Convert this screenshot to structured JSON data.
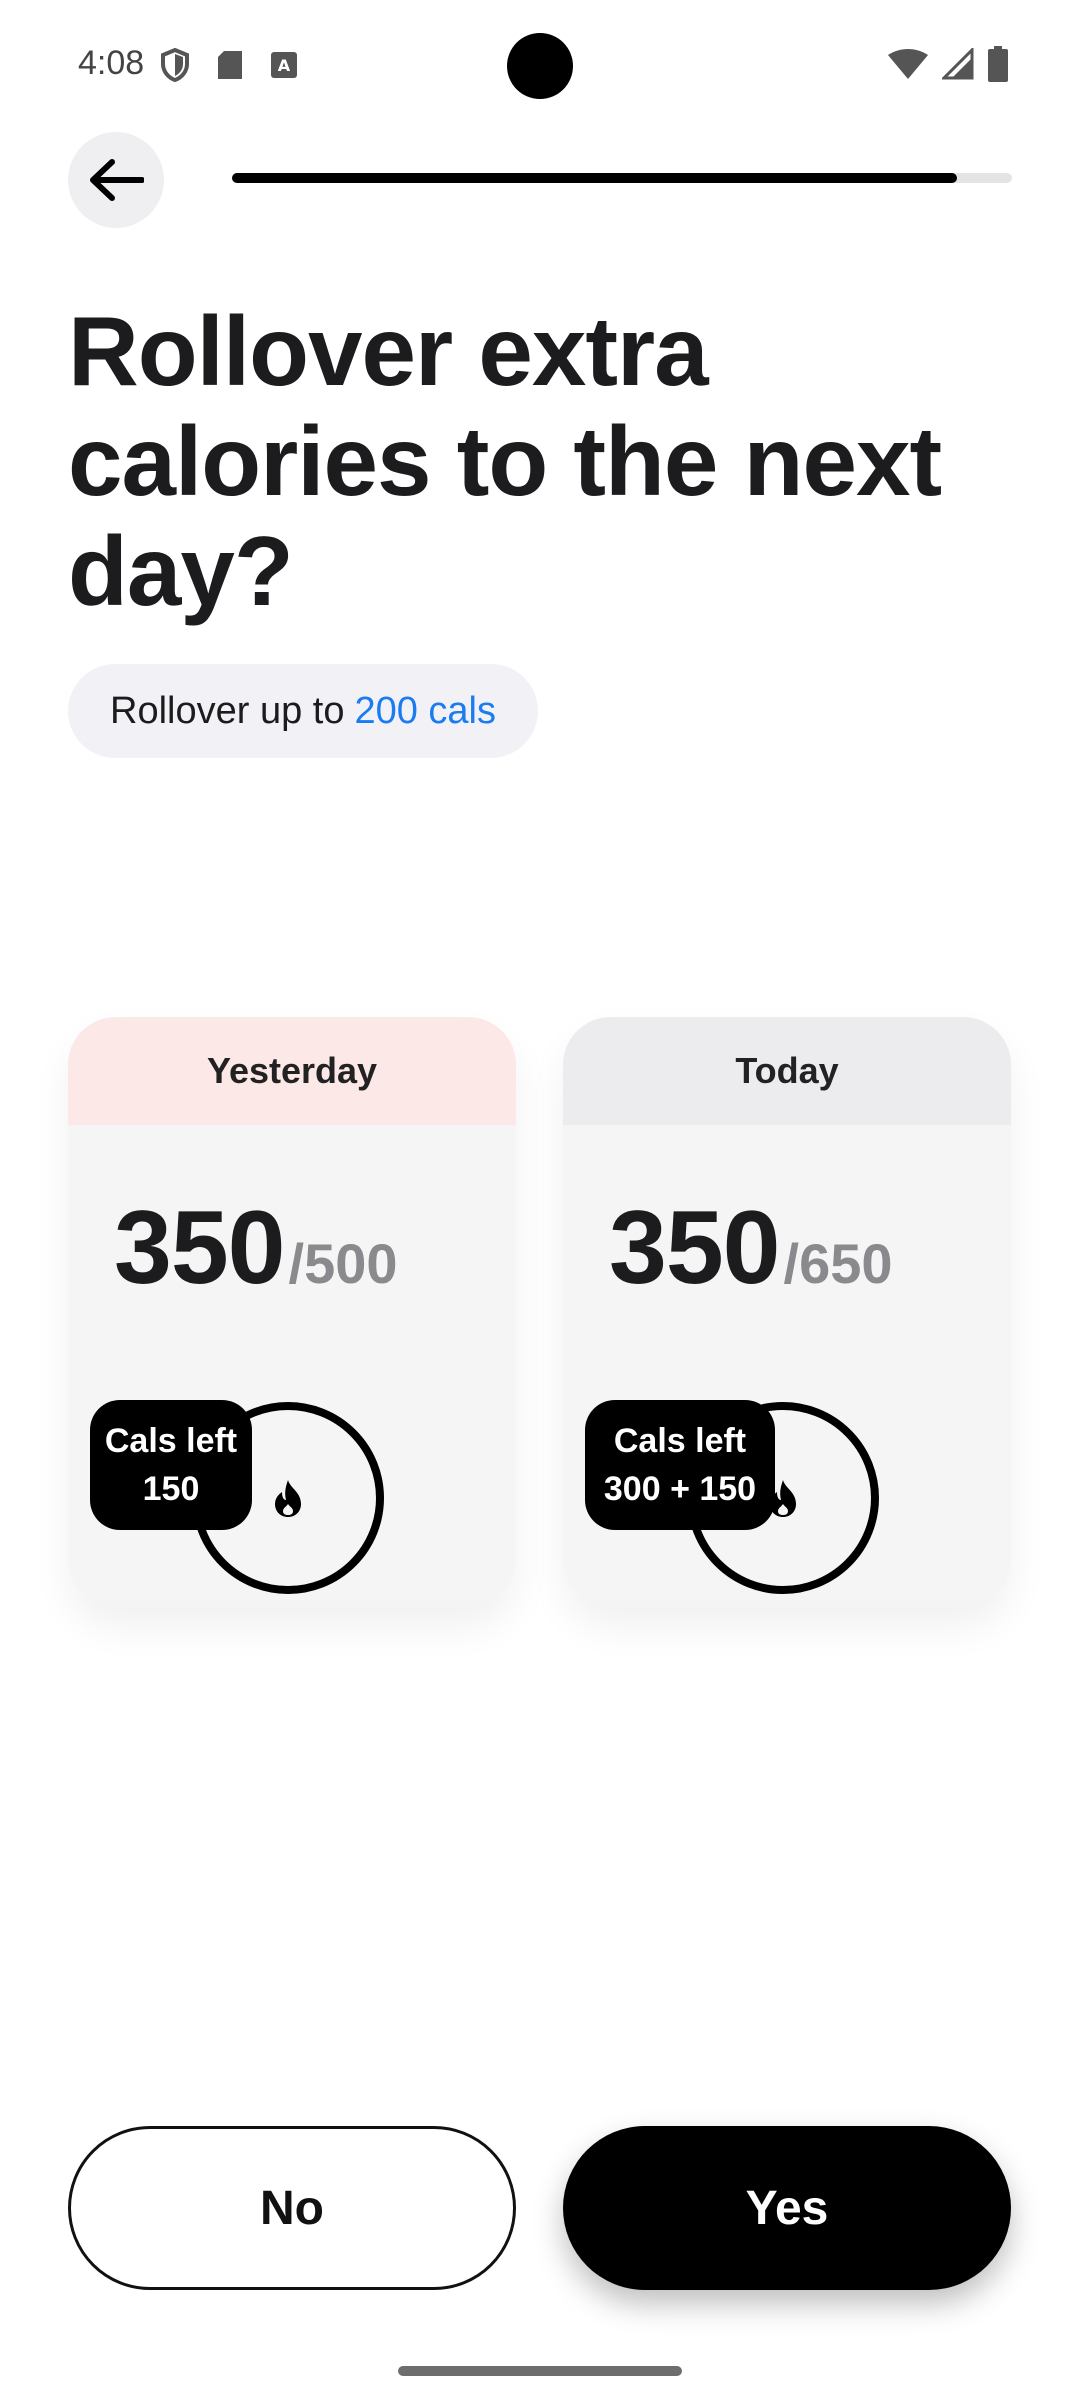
{
  "status_bar": {
    "time": "4:08",
    "left_icons": [
      "shield-icon",
      "sd-card-icon",
      "keyboard-a-icon"
    ],
    "right_icons": [
      "wifi-icon",
      "signal-icon",
      "battery-icon"
    ]
  },
  "header": {
    "back_icon": "arrow-left-icon",
    "progress_fraction": 0.93
  },
  "title": "Rollover extra calories to the next day?",
  "rollover_pill": {
    "prefix": "Rollover up to",
    "highlight": "200 cals",
    "highlight_color": "#1a7cf0"
  },
  "cards": {
    "yesterday": {
      "label": "Yesterday",
      "value": "350",
      "total": "/500",
      "badge_title": "Cals left",
      "badge_value": "150",
      "header_color": "#fde8e8"
    },
    "today": {
      "label": "Today",
      "value": "350",
      "total": "/650",
      "badge_title": "Cals left",
      "badge_value": "300 + 150",
      "header_color": "#ececef"
    }
  },
  "buttons": {
    "no_label": "No",
    "yes_label": "Yes"
  },
  "colors": {
    "primary": "#000000",
    "background": "#ffffff"
  }
}
